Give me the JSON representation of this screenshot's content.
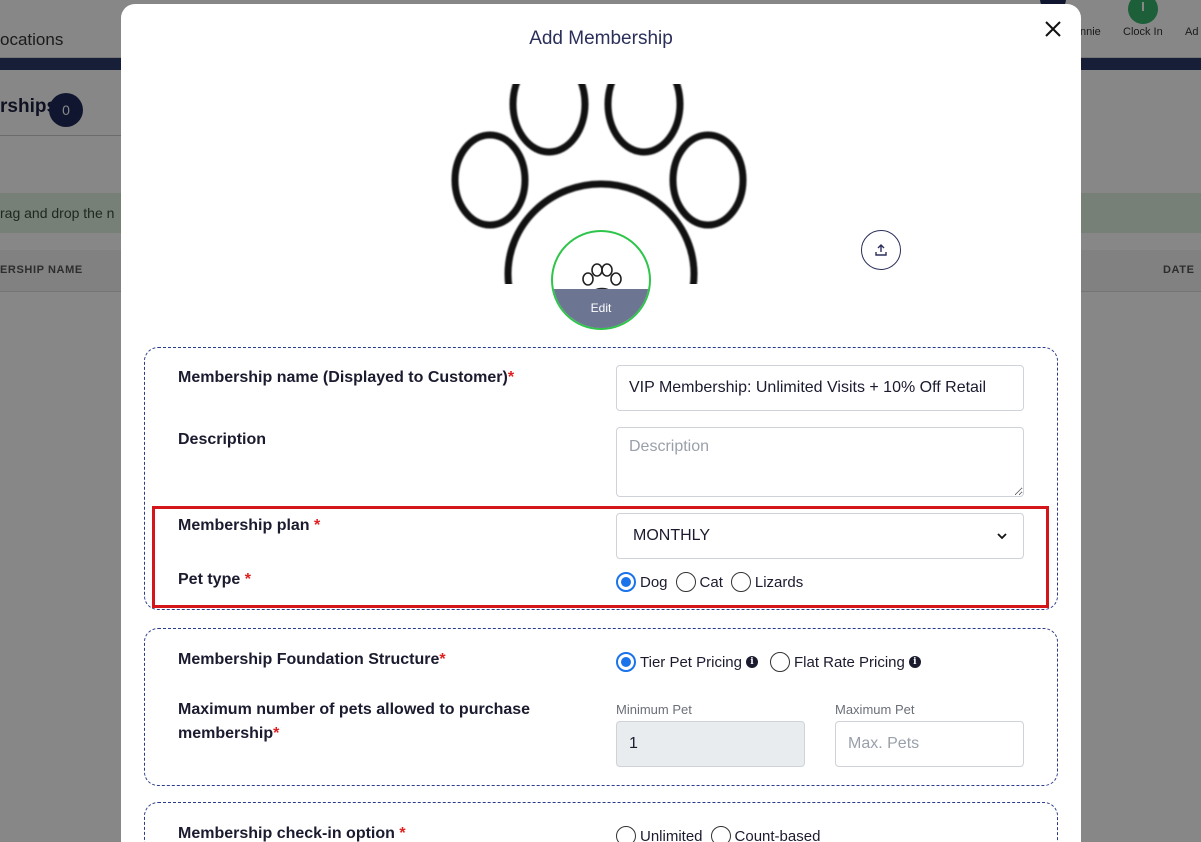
{
  "background": {
    "locations_fragment": "ocations",
    "memberships_fragment": "rships",
    "memberships_count": "0",
    "drag_hint_fragment": "rag and drop the n",
    "col_name_fragment": "ERSHIP NAME",
    "col_date": "DATE",
    "user_fragment": "nnie",
    "clock_in_label": "Clock In",
    "add_fragment": "Ad"
  },
  "modal": {
    "title": "Add Membership",
    "avatar_edit_label": "Edit"
  },
  "form": {
    "name_label": "Membership name (Displayed to Customer)",
    "name_value": "VIP Membership: Unlimited Visits + 10% Off Retail",
    "description_label": "Description",
    "description_placeholder": "Description",
    "plan_label": "Membership plan ",
    "plan_selected": "MONTHLY",
    "pet_type_label": "Pet type ",
    "pet_types": [
      "Dog",
      "Cat",
      "Lizards"
    ],
    "pet_type_selected": "Dog",
    "foundation_label": "Membership Foundation Structure",
    "foundation_options": [
      "Tier Pet Pricing",
      "Flat Rate Pricing"
    ],
    "foundation_selected": "Tier Pet Pricing",
    "max_pets_label": "Maximum number of pets allowed to purchase membership",
    "min_pet_label": "Minimum Pet",
    "min_pet_value": "1",
    "max_pet_label": "Maximum Pet",
    "max_pet_placeholder": "Max. Pets",
    "checkin_label": "Membership check-in option ",
    "checkin_options": [
      "Unlimited",
      "Count-based"
    ],
    "required_mark": "*"
  },
  "colors": {
    "accent": "#1a73e8",
    "highlight": "#d4161b",
    "section_border": "#2b3a8a",
    "avatar_ring": "#2ec54a"
  }
}
